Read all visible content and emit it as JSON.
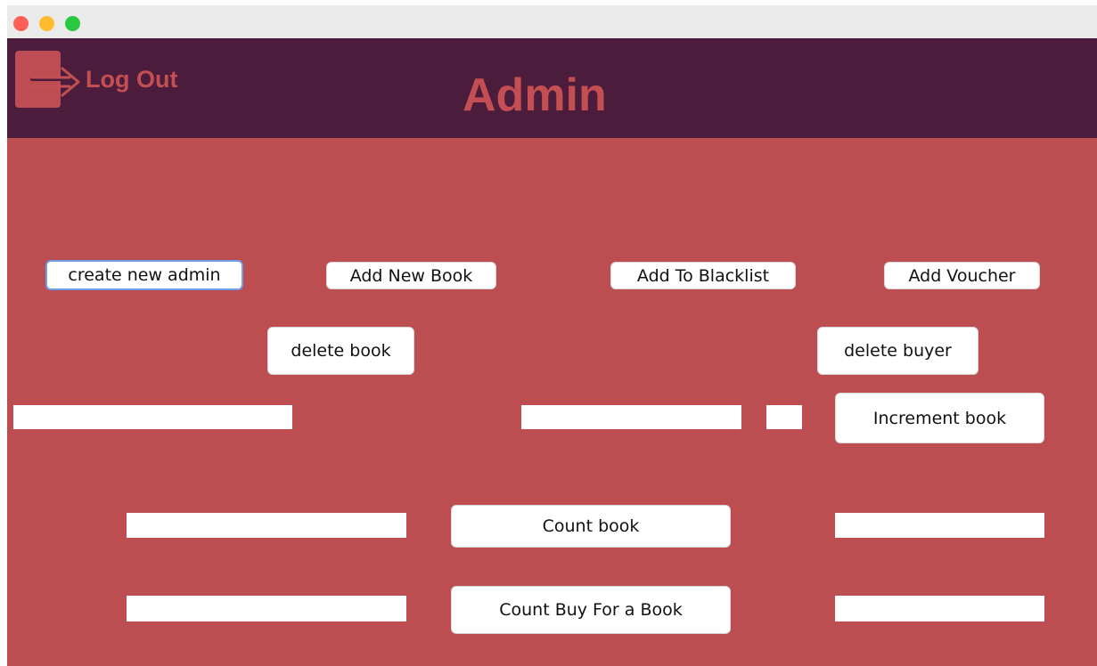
{
  "header": {
    "logout_label": "Log Out",
    "title": "Admin"
  },
  "buttons": {
    "create_new_admin": "create new admin",
    "add_new_book": "Add New Book",
    "add_to_blacklist": "Add To Blacklist",
    "add_voucher": "Add Voucher",
    "delete_book": "delete book",
    "delete_buyer": "delete buyer",
    "increment_book": "Increment book",
    "count_book": "Count book",
    "count_buy_for_a_book": "Count Buy For a Book"
  },
  "fields": {
    "delete_book_input": "",
    "increment_name_input": "",
    "increment_amount_input": "",
    "count_book_input": "",
    "count_book_result": "",
    "count_buy_input": "",
    "count_buy_result": ""
  },
  "colors": {
    "header_bg": "#4b1c3b",
    "main_bg": "#bc4e51",
    "accent_text": "#c44f53",
    "focus_ring": "#6d9ee6"
  },
  "icons": {
    "logout": "logout-arrow-icon"
  }
}
